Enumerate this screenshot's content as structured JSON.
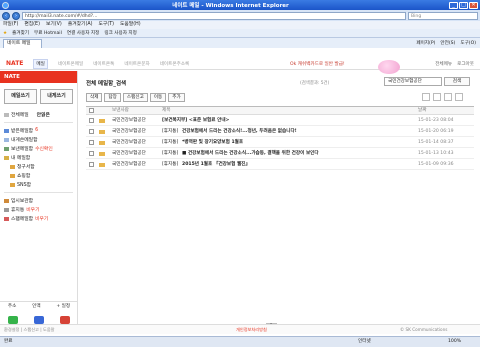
{
  "window": {
    "title": "네이트 메일 - Windows Internet Explorer",
    "url": "http://mail3.nate.com/#/dhd?...",
    "search_placeholder": "Bing"
  },
  "menu": [
    "파일(F)",
    "편집(E)",
    "보기(V)",
    "즐겨찾기(A)",
    "도구(T)",
    "도움말(H)"
  ],
  "favorites": [
    "즐겨찾기",
    "무료 Hotmail",
    "연결 사용자 지정",
    "링크 사용자 지정"
  ],
  "tab": {
    "label": "네이트 메일"
  },
  "tab_tools": [
    "페이지(P)",
    "안전(S)",
    "도구(O)"
  ],
  "gnb": {
    "logo": "NATE",
    "items": [
      "메일",
      "네이트온메일",
      "네이트온톡",
      "네이트온문자",
      "네이트온주소록"
    ],
    "promo": "Ok 캐쉬백카드로 일반 발급!",
    "links": [
      "전체메뉴",
      "로그아웃"
    ]
  },
  "sidebar": {
    "header": "NATE",
    "write_button": "메일쓰기",
    "write_me_button": "내게쓰기",
    "top_items": [
      {
        "label": "전체메일",
        "count": ""
      },
      {
        "label": "안읽은",
        "count": ""
      }
    ],
    "folders": [
      {
        "label": "받은메일함",
        "count": "6",
        "color": "#5c8ad8"
      },
      {
        "label": "내게쓴메일함",
        "count": "",
        "color": "#9bb7e0"
      },
      {
        "label": "보낸메일함",
        "count": "수신확인",
        "color": "#6fa06f"
      },
      {
        "label": "내 메일함",
        "count": "",
        "color": "#d6b046"
      }
    ],
    "subfolders": [
      {
        "label": "청구서함",
        "count": "",
        "color": "#e0a640"
      },
      {
        "label": "쇼핑함",
        "count": "",
        "color": "#e0a640"
      },
      {
        "label": "SNS함",
        "count": "",
        "color": "#e0a640"
      }
    ],
    "extra_folders": [
      {
        "label": "임시보관함",
        "count": "",
        "color": "#cf8a3a"
      },
      {
        "label": "휴지통",
        "count": "비우기",
        "color": "#9a9a9a"
      },
      {
        "label": "스팸메일함",
        "count": "비우기",
        "color": "#d65a5a"
      }
    ],
    "bottom_links": [
      "주소",
      "인맥",
      "+ 일정"
    ],
    "apps": [
      {
        "label": "NAVER",
        "color": "#35b34a"
      },
      {
        "label": "DAUM",
        "color": "#3867d6"
      },
      {
        "label": "GMAIL",
        "color": "#d64236"
      }
    ]
  },
  "main": {
    "title": "전체 메일함_검색",
    "note": "(검색결과: 5건)",
    "search_value": "국민건강보험공단",
    "search_button": "검색",
    "toolbar": [
      "삭제",
      "답장",
      "스팸신고",
      "이동",
      "추가"
    ],
    "columns": {
      "sender": "보낸사람",
      "subject": "제목",
      "date": "날짜"
    },
    "rows": [
      {
        "sender": "국민건강보험공단",
        "tag": "",
        "subject": "[보건복지부] <표준 보험료 안내>",
        "date": "15-01-23 08:04",
        "size": ""
      },
      {
        "sender": "국민건강보험공단",
        "tag": "[휴지통]",
        "subject": "건강보험에서 드리는 건강소식!...청년, 두려움은 없습니다!",
        "date": "15-01-20 06:19",
        "size": ""
      },
      {
        "sender": "국민건강보험공단",
        "tag": "[휴지통]",
        "subject": "*병역판 및 장기요양보험 1월호",
        "date": "15-01-14 08:37",
        "size": ""
      },
      {
        "sender": "국민건강보험공단",
        "tag": "[휴지통]",
        "subject": "■ 건강보험에서 드리는 건강소식...가습동, 결핵을 위한 건강이 보인다",
        "date": "15-01-13 10:43",
        "size": ""
      },
      {
        "sender": "국민건강보험공단",
        "tag": "[휴지통]",
        "subject": "2015년 1월호 『건강보험 웹진』",
        "date": "15-01-09 09:36",
        "size": ""
      }
    ],
    "pager": {
      "current": "1",
      "prev": "‹",
      "next": "›"
    }
  },
  "footer": {
    "left": "환경설정  |  스팸신고  |  도움말",
    "center": "개인정보처리방침",
    "right": "© SK Communications"
  },
  "status": {
    "left": "완료",
    "zone": "인터넷",
    "zoom": "100%"
  }
}
